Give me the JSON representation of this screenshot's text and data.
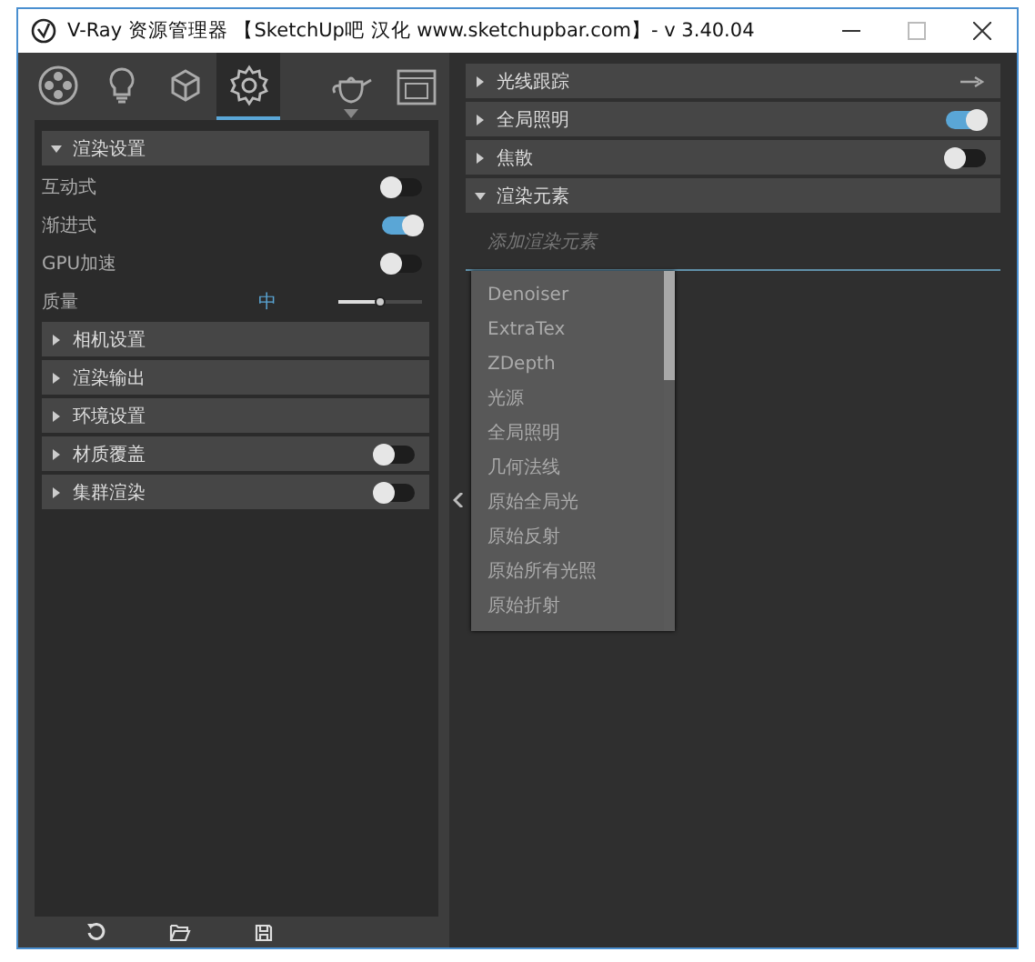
{
  "window": {
    "title": "V-Ray 资源管理器 【SketchUp吧 汉化 www.sketchupbar.com】- v 3.40.04"
  },
  "tabs": [
    {
      "kind": "scene",
      "selected": false
    },
    {
      "kind": "light",
      "selected": false
    },
    {
      "kind": "geometry",
      "selected": false
    },
    {
      "kind": "settings",
      "selected": true
    }
  ],
  "tools": [
    {
      "kind": "teapot",
      "dropdown": true
    },
    {
      "kind": "framebuffer",
      "dropdown": false
    }
  ],
  "left_sections": [
    {
      "title": "渲染设置",
      "expanded": true,
      "rows": [
        {
          "kind": "toggle",
          "label": "互动式",
          "on": false
        },
        {
          "kind": "toggle",
          "label": "渐进式",
          "on": true
        },
        {
          "kind": "toggle",
          "label": "GPU加速",
          "on": false
        },
        {
          "kind": "slider",
          "label": "质量",
          "reading": "中",
          "level": 0.5
        }
      ]
    },
    {
      "title": "相机设置",
      "expanded": false
    },
    {
      "title": "渲染输出",
      "expanded": false
    },
    {
      "title": "环境设置",
      "expanded": false
    },
    {
      "title": "材质覆盖",
      "expanded": false,
      "toggle": {
        "on": false
      }
    },
    {
      "title": "集群渲染",
      "expanded": false,
      "toggle": {
        "on": false
      }
    }
  ],
  "right_sections": [
    {
      "title": "光线跟踪",
      "expanded": false,
      "kind": "arrow"
    },
    {
      "title": "全局照明",
      "expanded": false,
      "kind": "toggle",
      "on": true
    },
    {
      "title": "焦散",
      "expanded": false,
      "kind": "toggle",
      "on": false
    },
    {
      "title": "渲染元素",
      "expanded": true,
      "kind": "search",
      "search": {
        "placeholder": "添加渲染元素"
      },
      "dropdown": [
        "Denoiser",
        "ExtraTex",
        "ZDepth",
        "光源",
        "全局照明",
        "几何法线",
        "原始全局光",
        "原始反射",
        "原始所有光照",
        "原始折射"
      ]
    }
  ],
  "footer": [
    {
      "kind": "reset"
    },
    {
      "kind": "open"
    },
    {
      "kind": "save"
    }
  ]
}
